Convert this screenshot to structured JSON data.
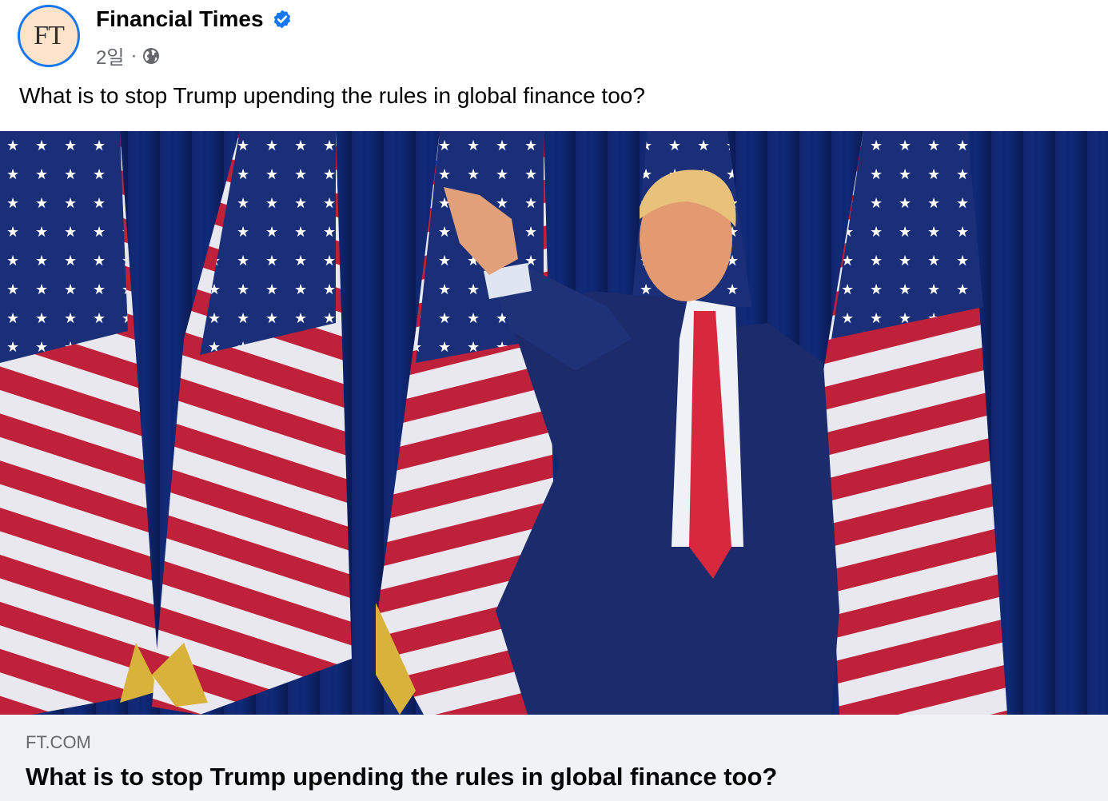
{
  "post": {
    "avatar_text": "FT",
    "page_name": "Financial Times",
    "verified_icon": "verified-badge-icon",
    "time": "2일",
    "separator": "·",
    "privacy_icon": "globe-icon",
    "caption": "What is to stop Trump upending the rules in global finance too?"
  },
  "link": {
    "domain": "FT.COM",
    "headline": "What is to stop Trump upending the rules in global finance too?"
  },
  "colors": {
    "accent_blue": "#1877f2",
    "avatar_bg": "#fce3c9",
    "card_bg": "#f0f2f5",
    "secondary_text": "#65676b"
  }
}
